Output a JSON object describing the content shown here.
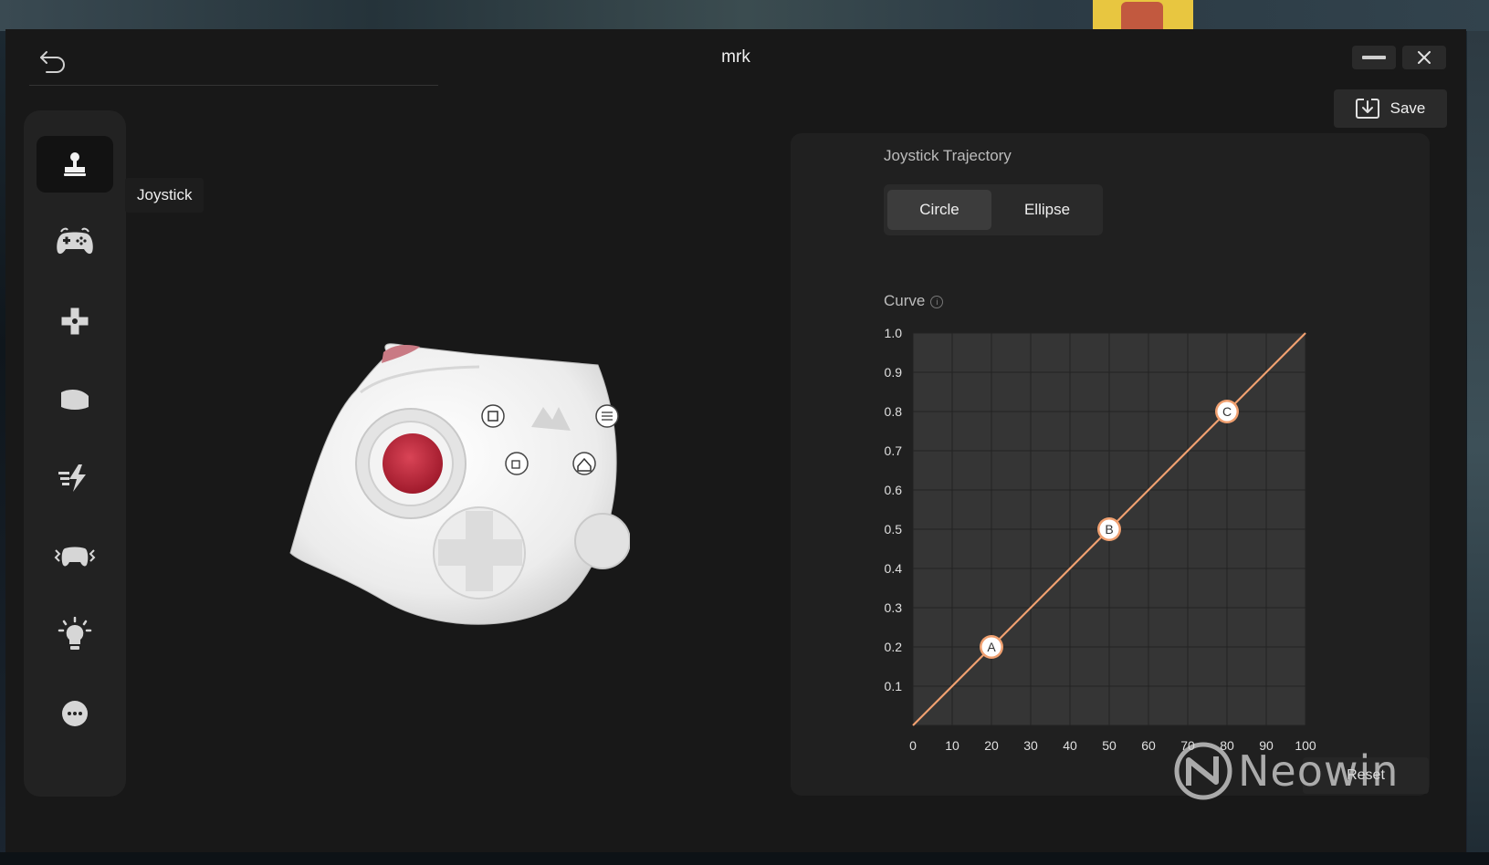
{
  "window": {
    "title": "mrk",
    "save_label": "Save"
  },
  "sidebar": {
    "tooltip": "Joystick",
    "items": [
      {
        "icon": "joystick-icon",
        "active": true
      },
      {
        "icon": "gamepad-icon",
        "active": false
      },
      {
        "icon": "dpad-icon",
        "active": false
      },
      {
        "icon": "trigger-icon",
        "active": false
      },
      {
        "icon": "turbo-icon",
        "active": false
      },
      {
        "icon": "vibration-icon",
        "active": false
      },
      {
        "icon": "lighting-icon",
        "active": false
      },
      {
        "icon": "more-icon",
        "active": false
      }
    ]
  },
  "trajectory": {
    "label": "Joystick Trajectory",
    "options": [
      "Circle",
      "Ellipse"
    ],
    "selected": "Circle"
  },
  "curve": {
    "label": "Curve",
    "reset_label": "Reset"
  },
  "chart_data": {
    "type": "line",
    "title": "",
    "xlabel": "",
    "ylabel": "",
    "xlim": [
      0,
      100
    ],
    "ylim": [
      0,
      1.0
    ],
    "x_ticks": [
      "0",
      "10",
      "20",
      "30",
      "40",
      "50",
      "60",
      "70",
      "80",
      "90",
      "100"
    ],
    "y_ticks": [
      "0.1",
      "0.2",
      "0.3",
      "0.4",
      "0.5",
      "0.6",
      "0.7",
      "0.8",
      "0.9",
      "1.0"
    ],
    "grid": true,
    "series": [
      {
        "x": [
          0,
          20,
          50,
          80,
          100
        ],
        "y": [
          0,
          0.2,
          0.5,
          0.8,
          1.0
        ]
      }
    ],
    "control_points": [
      {
        "label": "A",
        "x": 20,
        "y": 0.2
      },
      {
        "label": "B",
        "x": 50,
        "y": 0.5
      },
      {
        "label": "C",
        "x": 80,
        "y": 0.8
      }
    ]
  },
  "colors": {
    "accent": "#f0a070",
    "panel": "#202020",
    "background": "#181818"
  },
  "watermark": "Neowin"
}
